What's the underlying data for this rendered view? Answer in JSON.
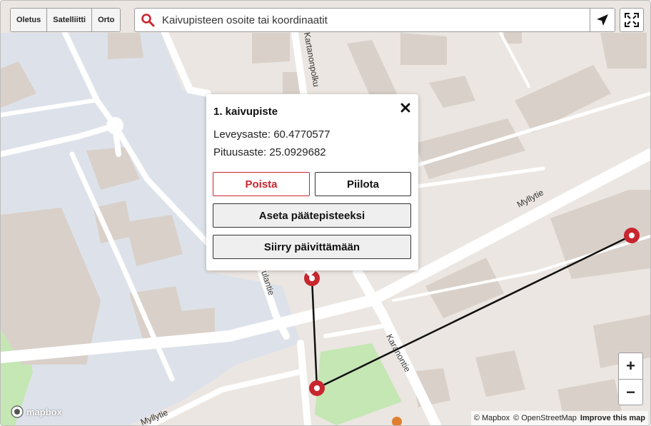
{
  "map_style_buttons": [
    "Oletus",
    "Satelliitti",
    "Orto"
  ],
  "search": {
    "placeholder": "Kaivupisteen osoite tai koordinaatit"
  },
  "streets": [
    "Kartanonpolku",
    "Myllytie",
    "Karanontie",
    "ulantie",
    "Myllytie"
  ],
  "popup": {
    "title": "1. kaivupiste",
    "latitude": "Leveysaste: 60.4770577",
    "longitude": "Pituusaste: 25.0929682",
    "delete_label": "Poista",
    "hide_label": "Piilota",
    "set_endpoint_label": "Aseta päätepisteeksi",
    "move_update_label": "Siirry päivittämään"
  },
  "zoom": {
    "in": "+",
    "out": "−"
  },
  "logo_text": "mapbox",
  "attribution": {
    "mapbox": "© Mapbox",
    "osm": "© OpenStreetMap",
    "improve": "Improve this map"
  },
  "colors": {
    "marker": "#c8262e",
    "danger": "#c8262e",
    "map_bg": "#ebe6e1",
    "building": "#d9d0c9",
    "landuse": "#dde2ea",
    "park": "#c4e7b3"
  }
}
